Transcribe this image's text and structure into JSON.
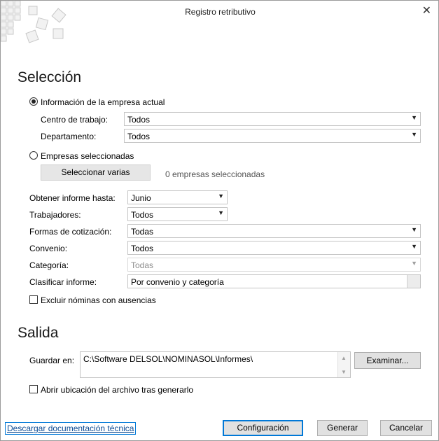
{
  "window": {
    "title": "Registro retributivo",
    "close_icon": "✕"
  },
  "seleccion": {
    "heading": "Selección",
    "opt_actual": "Información de la empresa actual",
    "centro_label": "Centro de trabajo:",
    "centro_value": "Todos",
    "depto_label": "Departamento:",
    "depto_value": "Todos",
    "opt_seleccionadas": "Empresas seleccionadas",
    "select_varias_btn": "Seleccionar varias",
    "empresas_count": "0 empresas seleccionadas",
    "hasta_label": "Obtener informe hasta:",
    "hasta_value": "Junio",
    "trabajadores_label": "Trabajadores:",
    "trabajadores_value": "Todos",
    "formas_label": "Formas de cotización:",
    "formas_value": "Todas",
    "convenio_label": "Convenio:",
    "convenio_value": "Todos",
    "categoria_label": "Categoría:",
    "categoria_value": "Todas",
    "clasificar_label": "Clasificar informe:",
    "clasificar_value": "Por convenio y categoría",
    "excluir_label": "Excluir nóminas con ausencias"
  },
  "salida": {
    "heading": "Salida",
    "guardar_label": "Guardar en:",
    "guardar_value": "C:\\Software DELSOL\\NOMINASOL\\Informes\\",
    "examinar_btn": "Examinar...",
    "abrir_label": "Abrir ubicación del archivo tras generarlo"
  },
  "footer": {
    "doc_link": "Descargar documentación técnica",
    "config_btn": "Configuración",
    "generar_btn": "Generar",
    "cancelar_btn": "Cancelar"
  },
  "icons": {
    "dropdown": "▼",
    "scroll_up": "▲",
    "scroll_down": "▼"
  }
}
